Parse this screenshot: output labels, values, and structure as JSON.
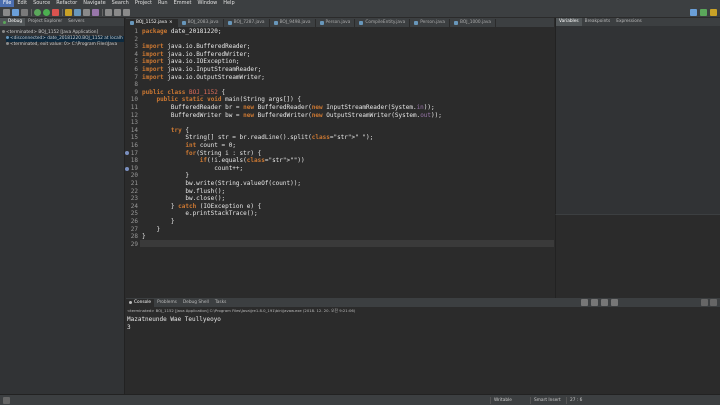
{
  "menu": [
    "File",
    "Edit",
    "Source",
    "Refactor",
    "Navigate",
    "Search",
    "Project",
    "Run",
    "Emmet",
    "Window",
    "Help"
  ],
  "left_panel": {
    "tabs": [
      "Debug",
      "Project Explorer",
      "Servers"
    ],
    "tree": [
      "<terminated> BOJ_1152 [Java Application]",
      "<disconnected> date_20181220.BOJ_1152 at localh",
      "<terminated, exit value: 0> C:\\Program Files\\Java"
    ]
  },
  "editor": {
    "tabs": [
      "BOJ_1152.java",
      "BOJ_2083.java",
      "BOJ_7287.java",
      "BOJ_9498.java",
      "Person.java",
      "CompileEntity.java",
      "Person.java",
      "BOJ_1000.java"
    ],
    "line_numbers": [
      "1",
      "2",
      "3",
      "4",
      "5",
      "6",
      "7",
      "8",
      "9",
      "10",
      "11",
      "12",
      "13",
      "14",
      "15",
      "16",
      "17",
      "18",
      "19",
      "20",
      "21",
      "22",
      "23",
      "24",
      "25",
      "26",
      "27",
      "28",
      "29"
    ],
    "lines": [
      "package date_20181220;",
      "",
      "import java.io.BufferedReader;",
      "import java.io.BufferedWriter;",
      "import java.io.IOException;",
      "import java.io.InputStreamReader;",
      "import java.io.OutputStreamWriter;",
      "",
      "public class BOJ_1152 {",
      "    public static void main(String args[]) {",
      "        BufferedReader br = new BufferedReader(new InputStreamReader(System.in));",
      "        BufferedWriter bw = new BufferedWriter(new OutputStreamWriter(System.out));",
      "",
      "        try {",
      "            String[] str = br.readLine().split(\" \");",
      "            int count = 0;",
      "            for(String i : str) {",
      "                if(!i.equals(\"\"))",
      "                    count++;",
      "            }",
      "            bw.write(String.valueOf(count));",
      "            bw.flush();",
      "            bw.close();",
      "        } catch (IOException e) {",
      "            e.printStackTrace();",
      "        }",
      "    }",
      "}",
      ""
    ]
  },
  "right_panel": {
    "tabs": [
      "Variables",
      "Breakpoints",
      "Expressions"
    ]
  },
  "console": {
    "tabs": [
      "Console",
      "Problems",
      "Debug Shell",
      "Tasks"
    ],
    "header": "<terminated> BOJ_1152 [Java Application] C:\\Program Files\\Java\\jre1.8.0_191\\bin\\javaw.exe (2018. 12. 20. 오전 9:21:06)",
    "output": [
      "Mazatneunde Wae Teullyeoyo",
      "3"
    ]
  },
  "status": {
    "mode": "Writable",
    "insert": "Smart Insert",
    "position": "27 : 6"
  },
  "colors": {
    "background": "#2b2b2b",
    "keyword": "#cc7832",
    "string": "#6a8759",
    "accent": "#4b6eaf"
  }
}
